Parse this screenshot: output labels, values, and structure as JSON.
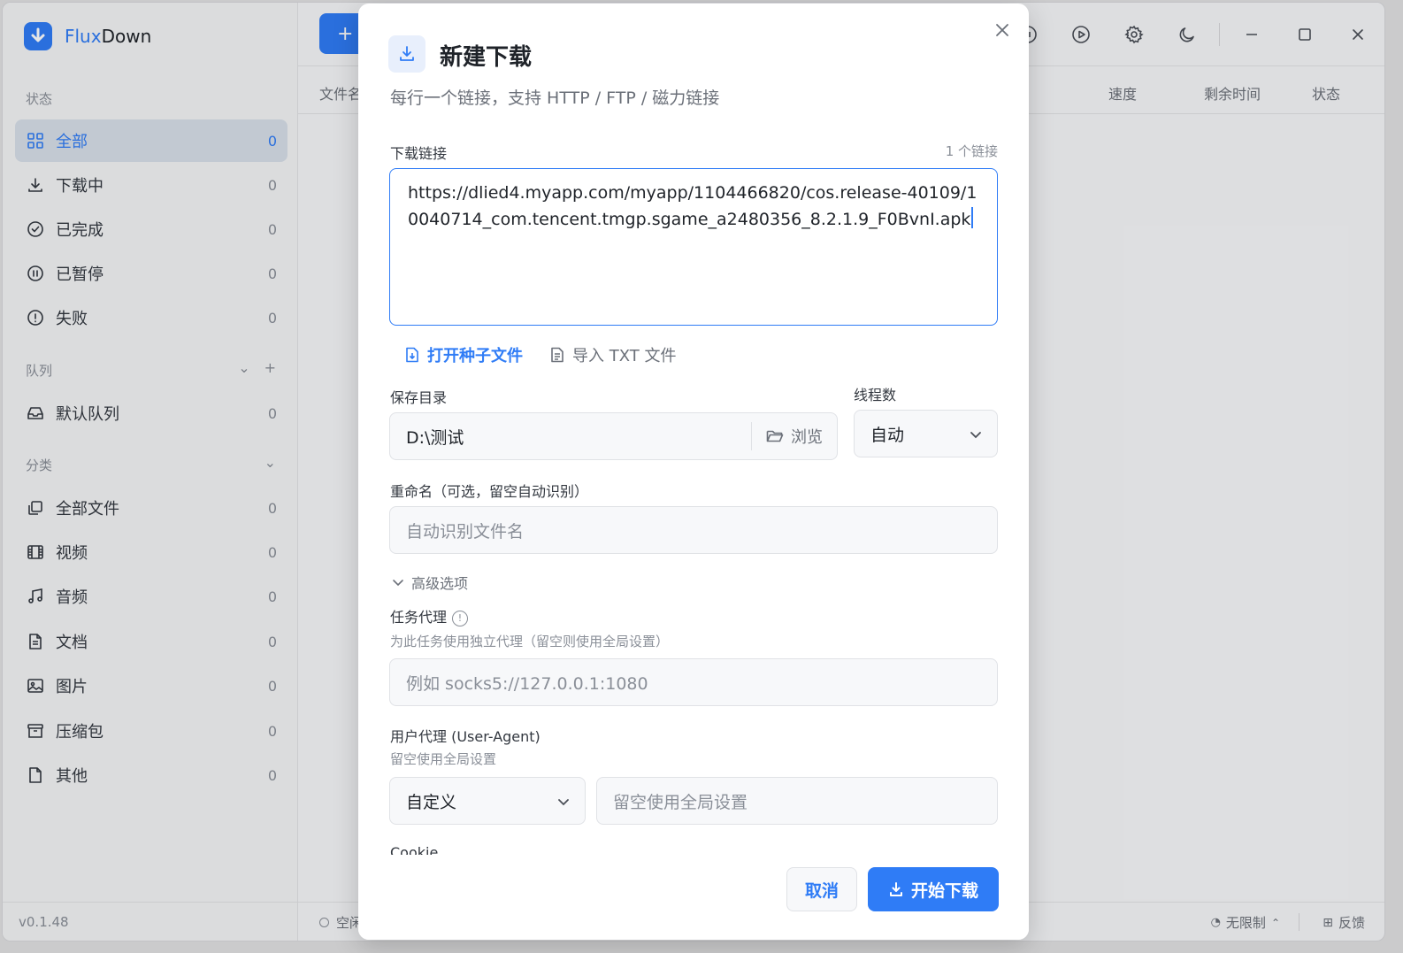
{
  "app": {
    "name_part1": "Flux",
    "name_part2": "Down",
    "version": "v0.1.48"
  },
  "sidebar": {
    "status_label": "状态",
    "status_items": [
      {
        "label": "全部",
        "count": "0",
        "icon": "grid-icon"
      },
      {
        "label": "下载中",
        "count": "0",
        "icon": "download-icon"
      },
      {
        "label": "已完成",
        "count": "0",
        "icon": "check-circle-icon"
      },
      {
        "label": "已暂停",
        "count": "0",
        "icon": "pause-circle-icon"
      },
      {
        "label": "失败",
        "count": "0",
        "icon": "alert-circle-icon"
      }
    ],
    "queue_label": "队列",
    "queue_items": [
      {
        "label": "默认队列",
        "count": "0",
        "icon": "inbox-icon"
      }
    ],
    "category_label": "分类",
    "category_items": [
      {
        "label": "全部文件",
        "count": "0",
        "icon": "files-icon"
      },
      {
        "label": "视频",
        "count": "0",
        "icon": "film-icon"
      },
      {
        "label": "音频",
        "count": "0",
        "icon": "music-icon"
      },
      {
        "label": "文档",
        "count": "0",
        "icon": "document-icon"
      },
      {
        "label": "图片",
        "count": "0",
        "icon": "image-icon"
      },
      {
        "label": "压缩包",
        "count": "0",
        "icon": "archive-icon"
      },
      {
        "label": "其他",
        "count": "0",
        "icon": "file-icon"
      }
    ]
  },
  "main": {
    "new_button": "+",
    "columns": {
      "filename": "文件名",
      "speed": "速度",
      "remaining": "剩余时间",
      "status": "状态"
    },
    "status_bar": {
      "state": "空闲",
      "speed_limit": "无限制",
      "feedback": "反馈"
    }
  },
  "dialog": {
    "title": "新建下载",
    "subtitle": "每行一个链接，支持 HTTP / FTP / 磁力链接",
    "links_label": "下载链接",
    "links_count": "1 个链接",
    "url_value": "https://dlied4.myapp.com/myapp/1104466820/cos.release-40109/10040714_com.tencent.tmgp.sgame_a2480356_8.2.1.9_F0BvnI.apk",
    "open_torrent": "打开种子文件",
    "import_txt": "导入 TXT 文件",
    "save_dir_label": "保存目录",
    "save_dir_value": "D:\\测试",
    "browse": "浏览",
    "threads_label": "线程数",
    "threads_value": "自动",
    "rename_label": "重命名（可选，留空自动识别）",
    "rename_placeholder": "自动识别文件名",
    "advanced": "高级选项",
    "proxy_label": "任务代理",
    "proxy_hint": "为此任务使用独立代理（留空则使用全局设置）",
    "proxy_placeholder": "例如 socks5://127.0.0.1:1080",
    "ua_label": "用户代理 (User-Agent)",
    "ua_hint": "留空使用全局设置",
    "ua_mode": "自定义",
    "ua_placeholder": "留空使用全局设置",
    "cookie_label": "Cookie",
    "cancel": "取消",
    "start": "开始下载"
  },
  "colors": {
    "accent": "#2f7cf6",
    "sidebar_active": "#d9e0ea"
  }
}
